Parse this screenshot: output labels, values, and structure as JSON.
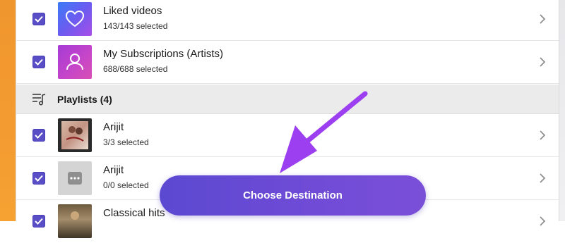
{
  "rows": [
    {
      "title": "Liked videos",
      "subtitle": "143/143 selected",
      "icon": "heart-icon"
    },
    {
      "title": "My Subscriptions (Artists)",
      "subtitle": "688/688 selected",
      "icon": "person-icon"
    }
  ],
  "section": {
    "label": "Playlists (4)",
    "icon": "playlist-icon"
  },
  "playlists": [
    {
      "title": "Arijit",
      "subtitle": "3/3 selected"
    },
    {
      "title": "Arijit",
      "subtitle": "0/0 selected"
    },
    {
      "title": "Classical hits",
      "subtitle": ""
    }
  ],
  "cta": {
    "label": "Choose Destination"
  },
  "colors": {
    "checkbox": "#5a4ec6",
    "cta_start": "#5b49d1",
    "cta_end": "#7a4fd8",
    "arrow": "#9b3ff0",
    "window_bg": "#f39a30"
  }
}
